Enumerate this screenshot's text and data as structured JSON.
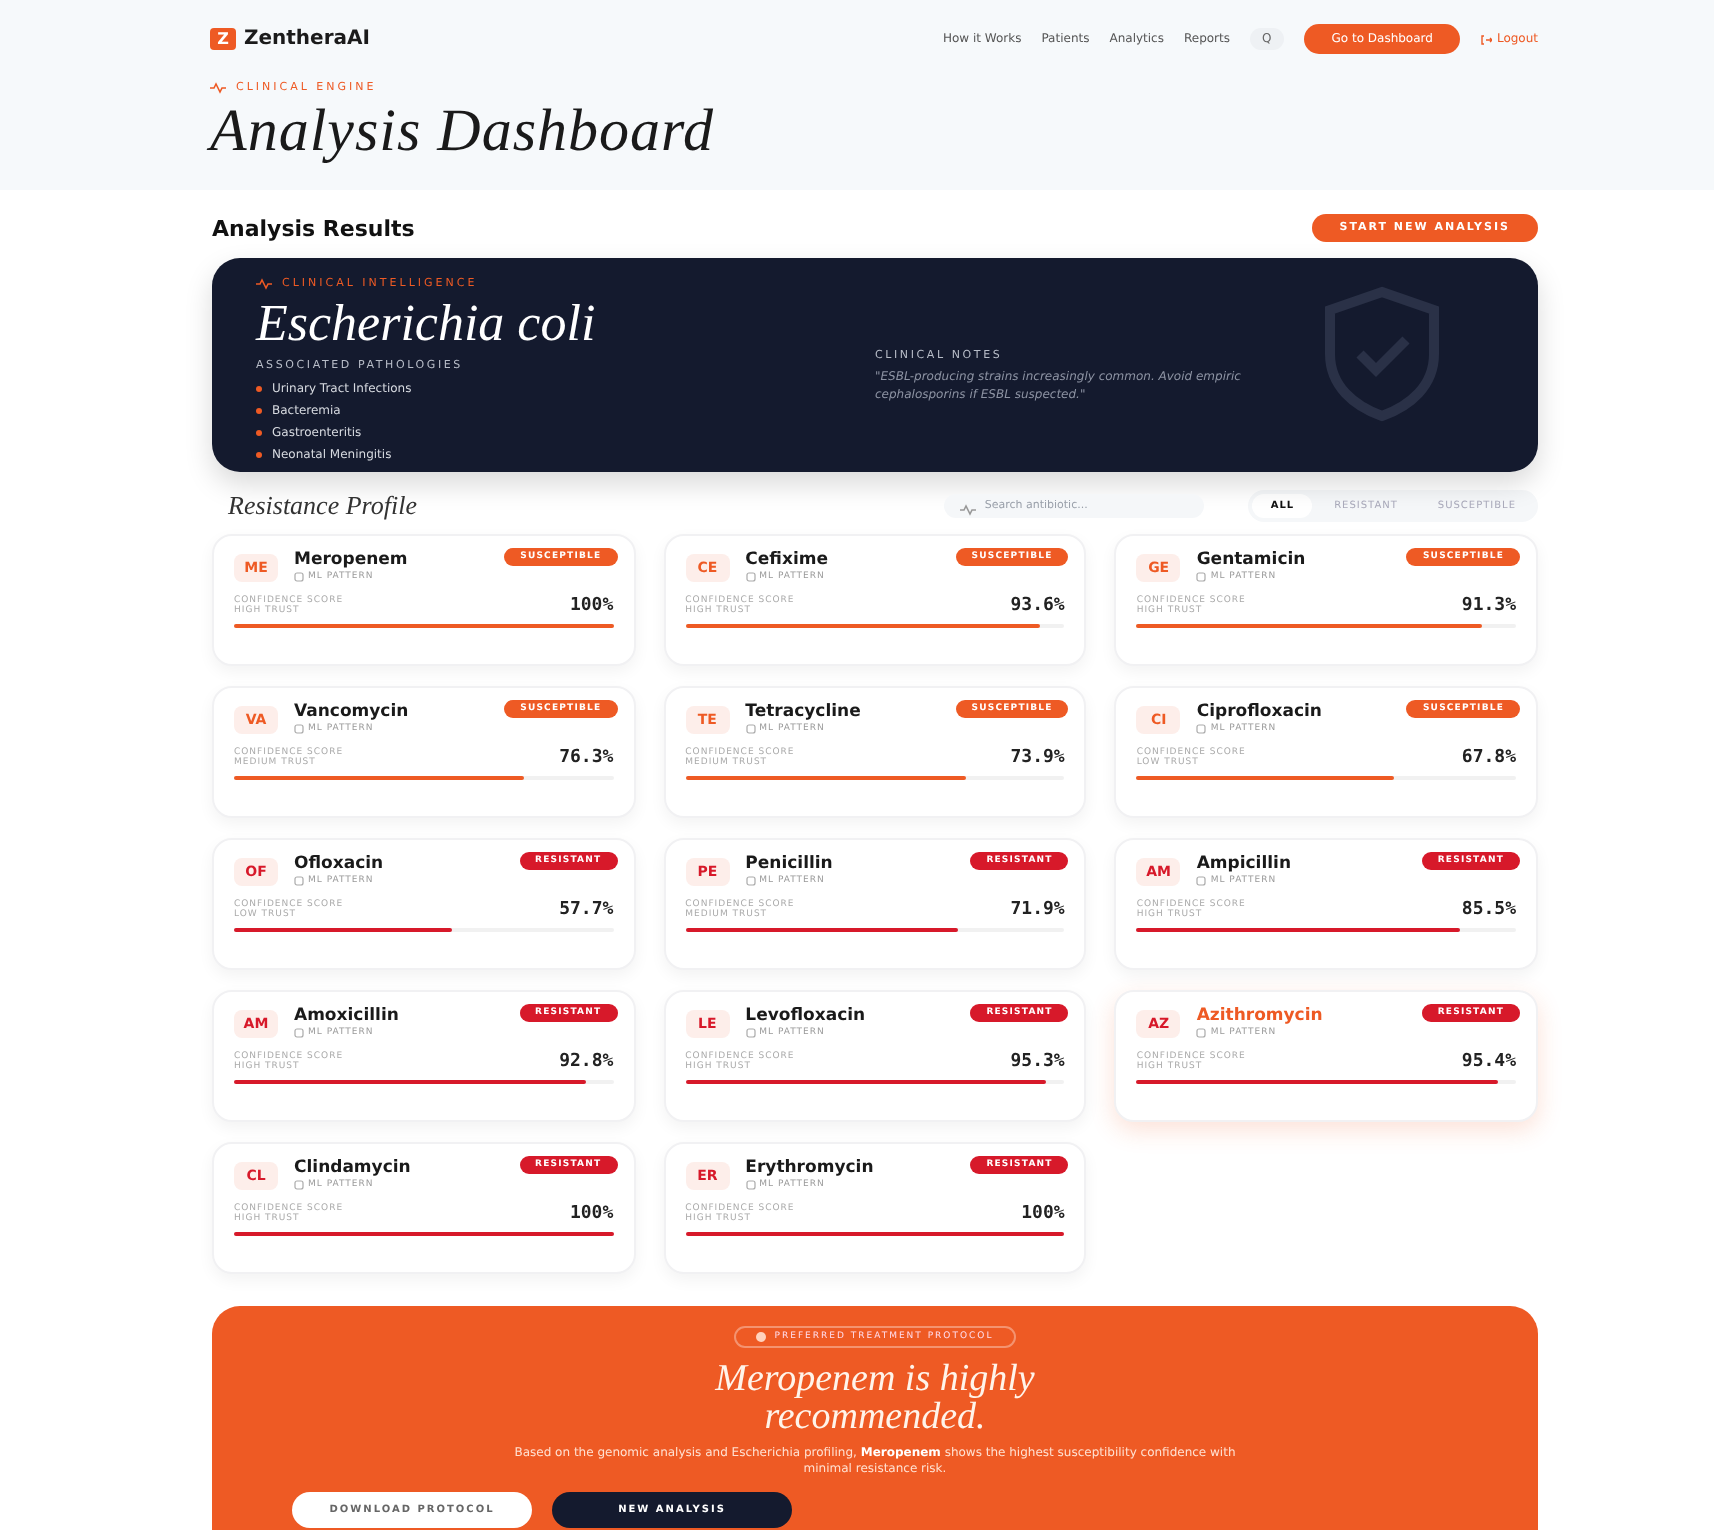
{
  "nav": {
    "logo_mark": "Z",
    "brand": "ZentheraAI",
    "links": [
      "How it Works",
      "Patients",
      "Analytics",
      "Reports"
    ],
    "search_glyph": "Q",
    "cta": "Go to Dashboard",
    "logout": "Logout"
  },
  "header": {
    "eyebrow": "CLINICAL ENGINE",
    "title": "Analysis Dashboard"
  },
  "results": {
    "title": "Analysis Results",
    "action": "START NEW ANALYSIS"
  },
  "organism": {
    "eyebrow": "CLINICAL INTELLIGENCE",
    "name": "Escherichia coli",
    "pathologies_label": "ASSOCIATED PATHOLOGIES",
    "pathologies": [
      "Urinary Tract Infections",
      "Bacteremia",
      "Gastroenteritis",
      "Neonatal Meningitis"
    ],
    "notes_label": "CLINICAL NOTES",
    "notes": "\"ESBL-producing strains increasingly common. Avoid empiric cephalosporins if ESBL suspected.\""
  },
  "profile": {
    "title": "Resistance Profile",
    "search_placeholder": "Search antibiotic...",
    "filters": [
      {
        "label": "ALL",
        "selected": true
      },
      {
        "label": "RESISTANT",
        "selected": false
      },
      {
        "label": "SUSCEPTIBLE",
        "selected": false
      }
    ]
  },
  "antibiotics": [
    {
      "abbr": "ME",
      "name": "Meropenem",
      "source": "ML PATTERN",
      "kind": "susceptible",
      "status": "SUSCEPTIBLE",
      "score_label": "CONFIDENCE SCORE",
      "trust": "HIGH TRUST",
      "score": "100%",
      "level": 1.0
    },
    {
      "abbr": "CE",
      "name": "Cefixime",
      "source": "ML PATTERN",
      "kind": "susceptible",
      "status": "SUSCEPTIBLE",
      "score_label": "CONFIDENCE SCORE",
      "trust": "HIGH TRUST",
      "score": "93.6%",
      "level": 0.936
    },
    {
      "abbr": "GE",
      "name": "Gentamicin",
      "source": "ML PATTERN",
      "kind": "susceptible",
      "status": "SUSCEPTIBLE",
      "score_label": "CONFIDENCE SCORE",
      "trust": "HIGH TRUST",
      "score": "91.3%",
      "level": 0.913
    },
    {
      "abbr": "VA",
      "name": "Vancomycin",
      "source": "ML PATTERN",
      "kind": "susceptible",
      "status": "SUSCEPTIBLE",
      "score_label": "CONFIDENCE SCORE",
      "trust": "MEDIUM TRUST",
      "score": "76.3%",
      "level": 0.763
    },
    {
      "abbr": "TE",
      "name": "Tetracycline",
      "source": "ML PATTERN",
      "kind": "susceptible",
      "status": "SUSCEPTIBLE",
      "score_label": "CONFIDENCE SCORE",
      "trust": "MEDIUM TRUST",
      "score": "73.9%",
      "level": 0.739
    },
    {
      "abbr": "CI",
      "name": "Ciprofloxacin",
      "source": "ML PATTERN",
      "kind": "susceptible",
      "status": "SUSCEPTIBLE",
      "score_label": "CONFIDENCE SCORE",
      "trust": "LOW TRUST",
      "score": "67.8%",
      "level": 0.678
    },
    {
      "abbr": "OF",
      "name": "Ofloxacin",
      "source": "ML PATTERN",
      "kind": "resistant",
      "status": "RESISTANT",
      "score_label": "CONFIDENCE SCORE",
      "trust": "LOW TRUST",
      "score": "57.7%",
      "level": 0.577
    },
    {
      "abbr": "PE",
      "name": "Penicillin",
      "source": "ML PATTERN",
      "kind": "resistant",
      "status": "RESISTANT",
      "score_label": "CONFIDENCE SCORE",
      "trust": "MEDIUM TRUST",
      "score": "71.9%",
      "level": 0.719
    },
    {
      "abbr": "AM",
      "name": "Ampicillin",
      "source": "ML PATTERN",
      "kind": "resistant",
      "status": "RESISTANT",
      "score_label": "CONFIDENCE SCORE",
      "trust": "HIGH TRUST",
      "score": "85.5%",
      "level": 0.855
    },
    {
      "abbr": "AM",
      "name": "Amoxicillin",
      "source": "ML PATTERN",
      "kind": "resistant",
      "status": "RESISTANT",
      "score_label": "CONFIDENCE SCORE",
      "trust": "HIGH TRUST",
      "score": "92.8%",
      "level": 0.928
    },
    {
      "abbr": "LE",
      "name": "Levofloxacin",
      "source": "ML PATTERN",
      "kind": "resistant",
      "status": "RESISTANT",
      "score_label": "CONFIDENCE SCORE",
      "trust": "HIGH TRUST",
      "score": "95.3%",
      "level": 0.953
    },
    {
      "abbr": "AZ",
      "name": "Azithromycin",
      "source": "ML PATTERN",
      "kind": "resistant",
      "status": "RESISTANT",
      "score_label": "CONFIDENCE SCORE",
      "trust": "HIGH TRUST",
      "score": "95.4%",
      "level": 0.954,
      "highlighted": true
    },
    {
      "abbr": "CL",
      "name": "Clindamycin",
      "source": "ML PATTERN",
      "kind": "resistant",
      "status": "RESISTANT",
      "score_label": "CONFIDENCE SCORE",
      "trust": "HIGH TRUST",
      "score": "100%",
      "level": 1.0
    },
    {
      "abbr": "ER",
      "name": "Erythromycin",
      "source": "ML PATTERN",
      "kind": "resistant",
      "status": "RESISTANT",
      "score_label": "CONFIDENCE SCORE",
      "trust": "HIGH TRUST",
      "score": "100%",
      "level": 1.0
    }
  ],
  "recommendation": {
    "badge": "PREFERRED TREATMENT PROTOCOL",
    "headline": "Meropenem is highly recommended.",
    "text": "Based on the genomic analysis and Escherichia profiling, **Meropenem** shows the highest susceptibility confidence with minimal resistance risk.",
    "buttons": [
      {
        "label": "DOWNLOAD PROTOCOL",
        "kind": "light"
      },
      {
        "label": "NEW ANALYSIS",
        "kind": "dark"
      }
    ]
  }
}
